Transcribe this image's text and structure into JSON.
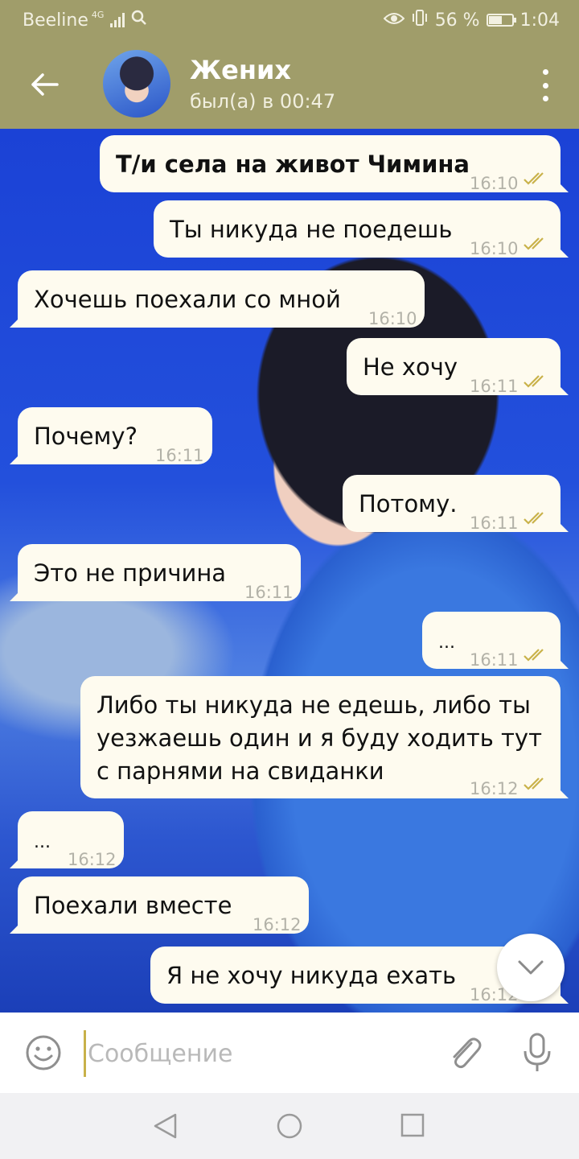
{
  "status_bar": {
    "carrier": "Beeline",
    "network": "4G",
    "battery": "56 %",
    "battery_level": 0.56,
    "time": "1:04"
  },
  "header": {
    "title": "Жених",
    "status": "был(а) в 00:47"
  },
  "messages": [
    {
      "direction": "out",
      "text": "Т/и села на живот Чимина",
      "time": "16:10",
      "bold": true,
      "read": true
    },
    {
      "direction": "out",
      "text": "Ты никуда не поедешь",
      "time": "16:10",
      "read": true
    },
    {
      "direction": "in",
      "text": "Хочешь поехали со мной",
      "time": "16:10"
    },
    {
      "direction": "out",
      "text": "Не хочу",
      "time": "16:11",
      "read": true
    },
    {
      "direction": "in",
      "text": "Почему?",
      "time": "16:11"
    },
    {
      "direction": "out",
      "text": "Потому.",
      "time": "16:11",
      "read": true
    },
    {
      "direction": "in",
      "text": "Это не причина",
      "time": "16:11"
    },
    {
      "direction": "out",
      "text": "...",
      "time": "16:11",
      "read": true
    },
    {
      "direction": "out",
      "text": "Либо ты никуда не едешь, либо ты\nуезжаешь один и я буду ходить тут\nс парнями на свиданки",
      "time": "16:12",
      "read": true
    },
    {
      "direction": "in",
      "text": "...",
      "time": "16:12"
    },
    {
      "direction": "in",
      "text": "Поехали вместе",
      "time": "16:12"
    },
    {
      "direction": "out",
      "text": "Я не хочу никуда ехать",
      "time": "16:12",
      "read": true
    }
  ],
  "input": {
    "placeholder": "Сообщение"
  },
  "colors": {
    "header": "#a09d6a",
    "bubble": "#fefbef",
    "read_check": "#c9b24a",
    "time_text": "#b3b2a8"
  },
  "icons": [
    "back-arrow-icon",
    "more-vert-icon",
    "emoji-icon",
    "attach-icon",
    "mic-icon",
    "chevron-down-icon",
    "double-check-icon"
  ]
}
